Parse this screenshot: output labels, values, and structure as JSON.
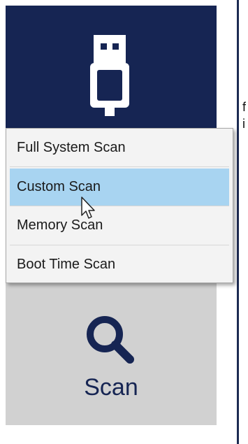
{
  "sidebar": {
    "top_icon": "usb-icon",
    "scan_icon": "search-icon",
    "scan_label": "Scan"
  },
  "menu": {
    "items": [
      {
        "label": "Full System Scan",
        "highlighted": false
      },
      {
        "label": "Custom Scan",
        "highlighted": true
      },
      {
        "label": "Memory Scan",
        "highlighted": false
      },
      {
        "label": "Boot Time Scan",
        "highlighted": false
      }
    ]
  },
  "side_text": {
    "line1": "f",
    "line2": "i"
  },
  "colors": {
    "sidebar_dark": "#162553",
    "sidebar_light": "#d1d1d1",
    "menu_bg": "#f3f3f3",
    "menu_highlight": "#a8d4f1"
  }
}
